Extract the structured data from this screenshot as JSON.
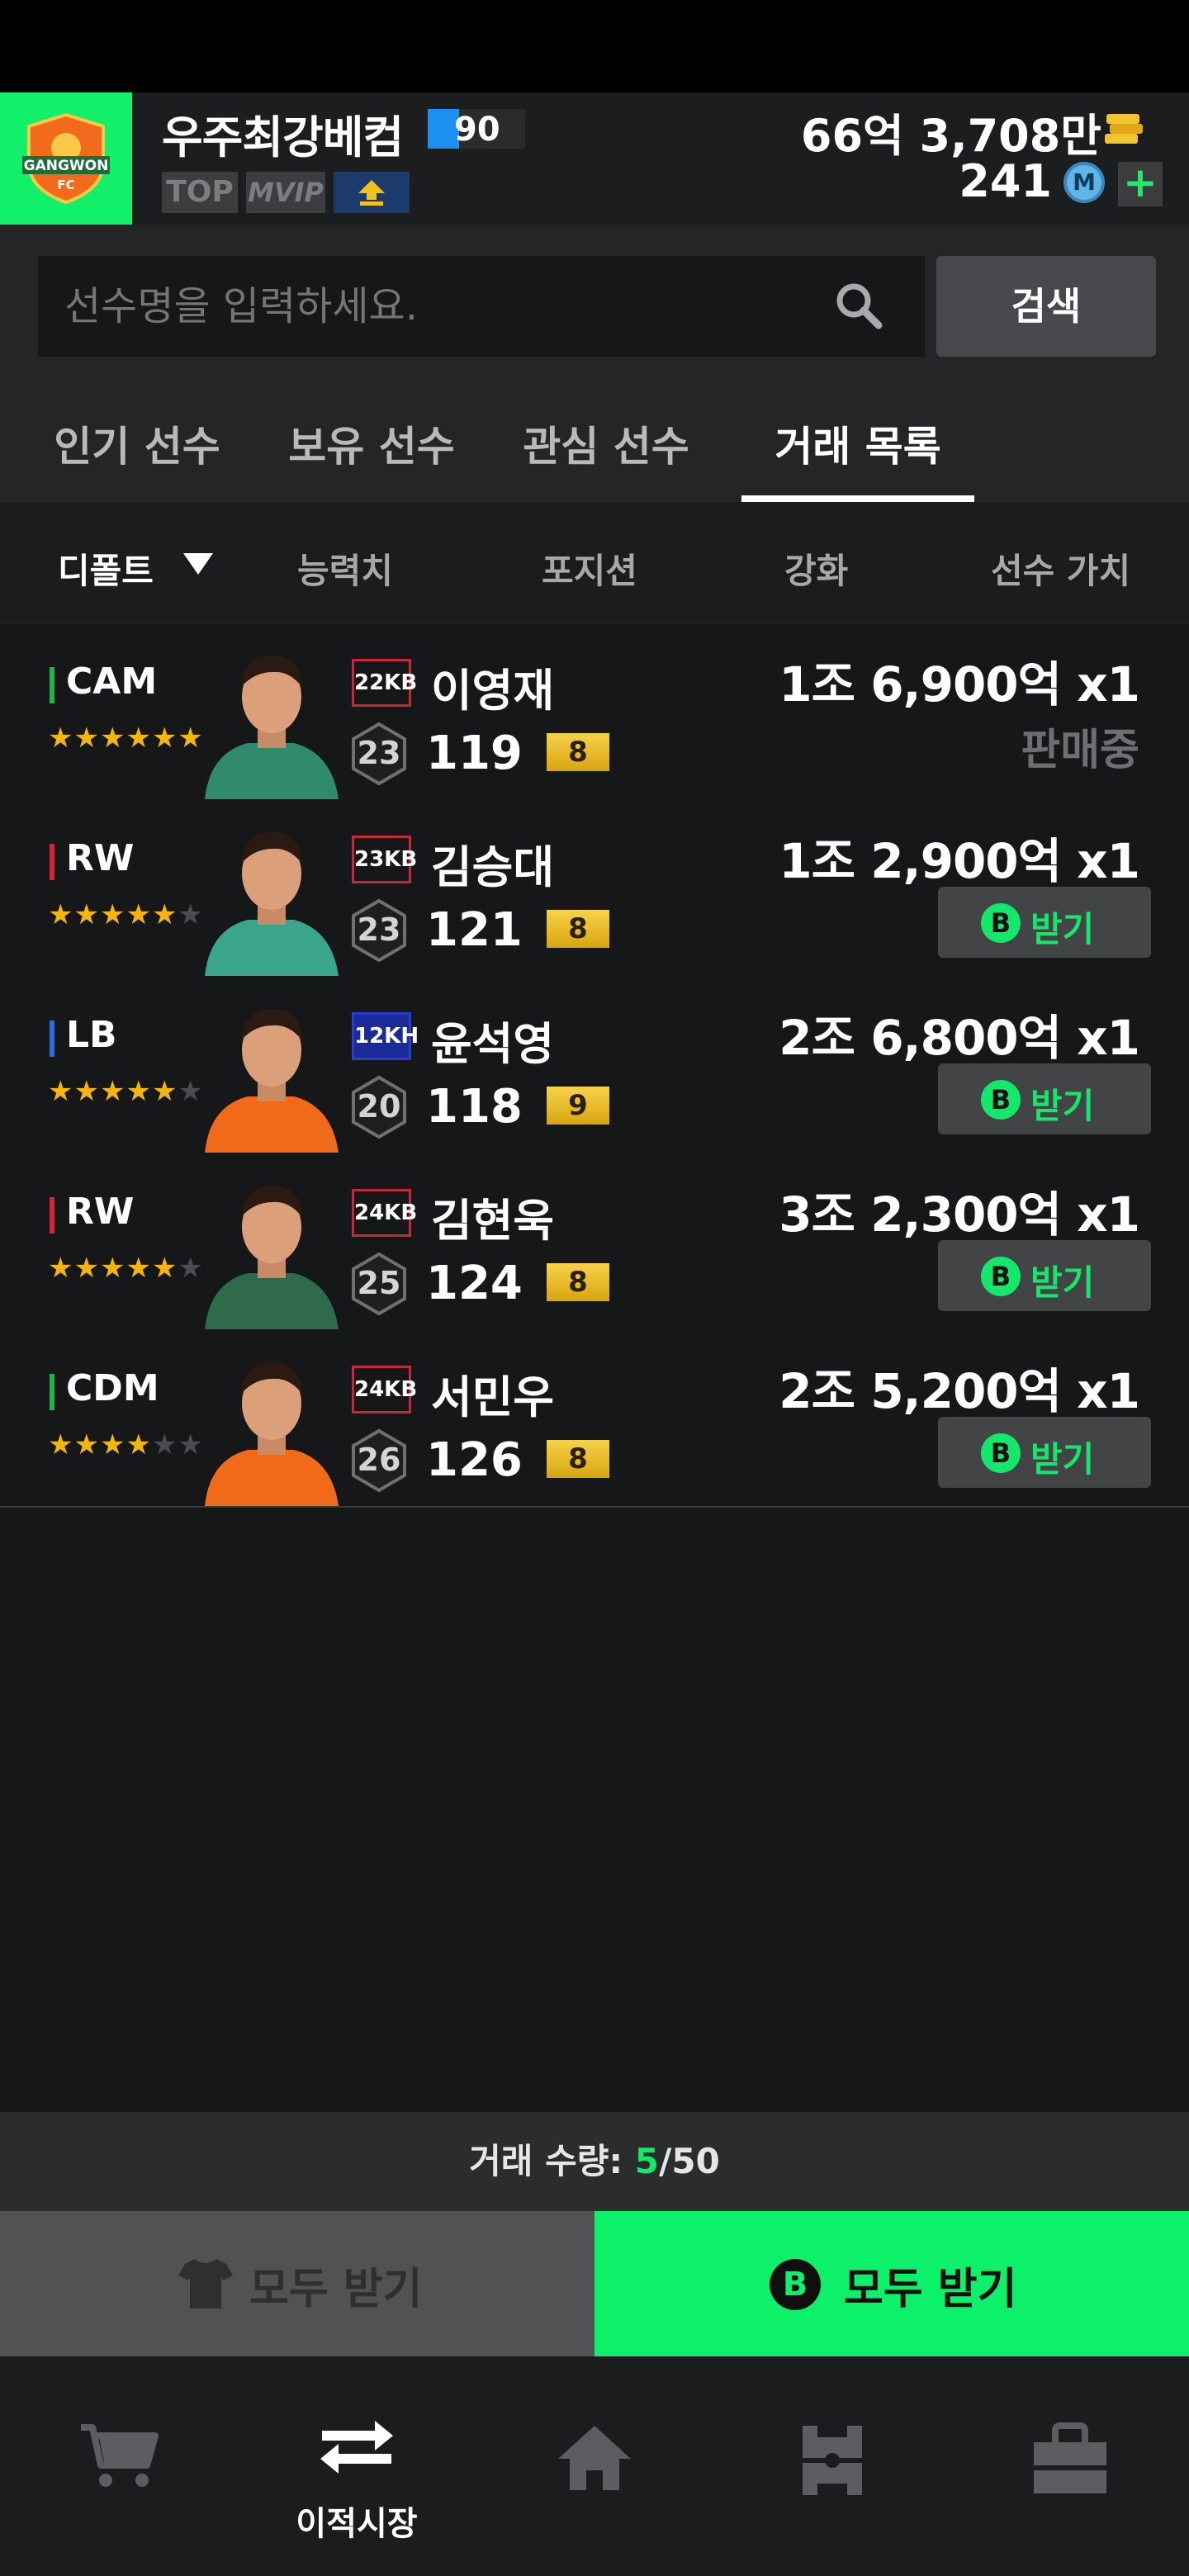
{
  "header": {
    "username": "우주최강베컴",
    "level": "90",
    "level_progress": 0.32,
    "tags": {
      "top": "TOP",
      "vip": "MVIP"
    },
    "club_badge_text": "GANGWON FC",
    "coins": "66억 3,708만",
    "mpoints": "241",
    "m_icon_letter": "M",
    "plus_symbol": "+"
  },
  "search": {
    "placeholder": "선수명을 입력하세요.",
    "button_label": "검색"
  },
  "tabs": [
    {
      "label": "인기 선수",
      "active": false
    },
    {
      "label": "보유 선수",
      "active": false
    },
    {
      "label": "관심 선수",
      "active": false
    },
    {
      "label": "거래 목록",
      "active": true
    }
  ],
  "sort": {
    "default_label": "디폴트",
    "columns": [
      "능력치",
      "포지션",
      "강화",
      "선수 가치"
    ]
  },
  "players": [
    {
      "position": "CAM",
      "position_color": "#22b34a",
      "stars": 6,
      "season": "22KB",
      "name": "이영재",
      "salary": "23",
      "ovr": "119",
      "upgrade": "8",
      "price": "1조 6,900억 x1",
      "status": "판매중",
      "has_receive": false,
      "jersey": "#2f8b6b"
    },
    {
      "position": "RW",
      "position_color": "#d2263a",
      "stars": 5,
      "season": "23KB",
      "name": "김승대",
      "salary": "23",
      "ovr": "121",
      "upgrade": "8",
      "price": "1조 2,900억 x1",
      "status": "",
      "has_receive": true,
      "jersey": "#3aa58a"
    },
    {
      "position": "LB",
      "position_color": "#2a6fe0",
      "stars": 5,
      "season": "12KH",
      "name": "윤석영",
      "salary": "20",
      "ovr": "118",
      "upgrade": "9",
      "price": "2조 6,800억 x1",
      "status": "",
      "has_receive": true,
      "jersey": "#f06a1a"
    },
    {
      "position": "RW",
      "position_color": "#d2263a",
      "stars": 5,
      "season": "24KB",
      "name": "김현욱",
      "salary": "25",
      "ovr": "124",
      "upgrade": "8",
      "price": "3조 2,300억 x1",
      "status": "",
      "has_receive": true,
      "jersey": "#2f6a4a"
    },
    {
      "position": "CDM",
      "position_color": "#22b34a",
      "stars": 4,
      "season": "24KB",
      "name": "서민우",
      "salary": "26",
      "ovr": "126",
      "upgrade": "8",
      "price": "2조 5,200억 x1",
      "status": "",
      "has_receive": true,
      "jersey": "#f06a1a"
    }
  ],
  "receive_label": "받기",
  "b_letter": "B",
  "trade": {
    "label": "거래 수량: ",
    "current": "5",
    "total": "/50"
  },
  "footer_buttons": {
    "receive_all_left": "모두 받기",
    "receive_all_right": "모두 받기"
  },
  "nav": [
    {
      "icon": "cart-icon",
      "label": ""
    },
    {
      "icon": "transfer-icon",
      "label": "이적시장"
    },
    {
      "icon": "home-icon",
      "label": ""
    },
    {
      "icon": "squad-icon",
      "label": ""
    },
    {
      "icon": "store-icon",
      "label": ""
    }
  ],
  "colors": {
    "accent_green": "#14e86a",
    "badge_green": "#12f06a",
    "upgrade_gold": "#e8bb20",
    "star_gold": "#f5b50c"
  }
}
